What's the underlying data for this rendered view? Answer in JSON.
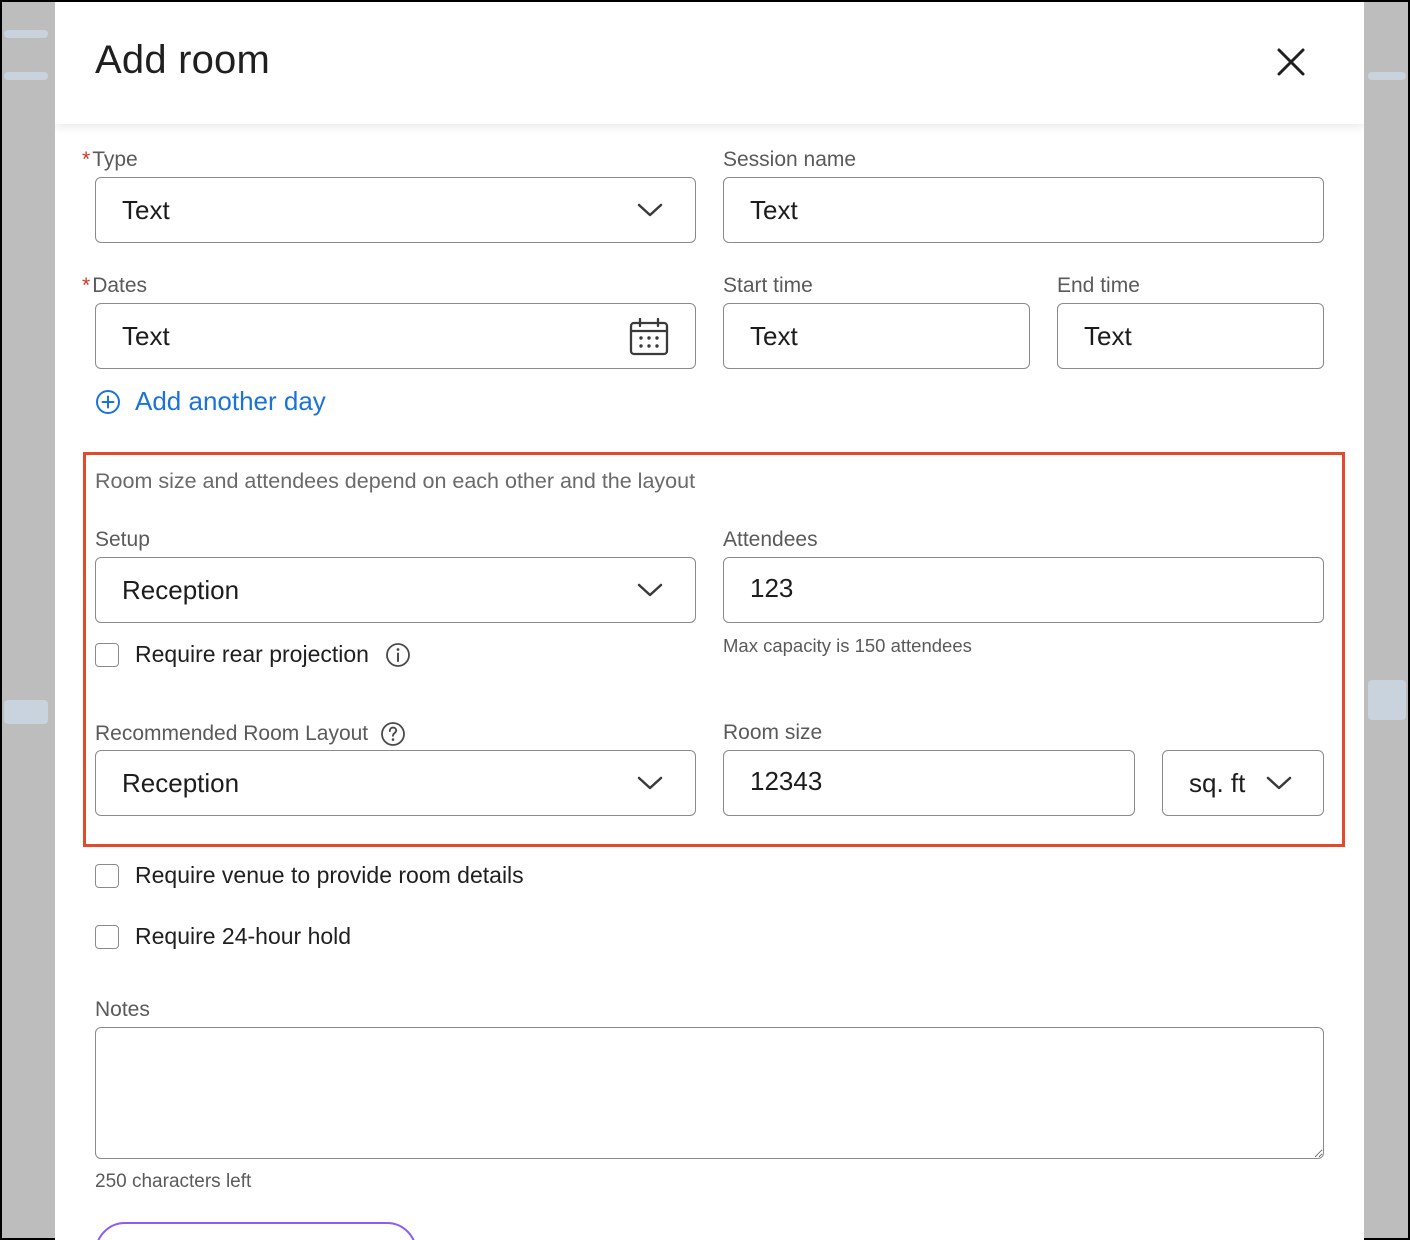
{
  "dialog": {
    "title": "Add room"
  },
  "form": {
    "type": {
      "label": "Type",
      "required": true,
      "value": "Text"
    },
    "session_name": {
      "label": "Session name",
      "value": "Text"
    },
    "dates": {
      "label": "Dates",
      "required": true,
      "value": "Text"
    },
    "start_time": {
      "label": "Start time",
      "value": "Text"
    },
    "end_time": {
      "label": "End time",
      "value": "Text"
    },
    "add_day_link": "Add another day"
  },
  "room_section": {
    "hint": "Room size and attendees depend on each other and the layout",
    "setup": {
      "label": "Setup",
      "value": "Reception"
    },
    "attendees": {
      "label": "Attendees",
      "value": "123",
      "help": "Max capacity is 150 attendees"
    },
    "rear_projection": {
      "label": "Require rear projection",
      "checked": false
    },
    "recommended_layout": {
      "label": "Recommended Room Layout",
      "value": "Reception"
    },
    "room_size": {
      "label": "Room size",
      "value": "12343",
      "unit": "sq. ft"
    }
  },
  "options": {
    "venue_details": {
      "label": "Require venue to provide room details",
      "checked": false
    },
    "hold_24h": {
      "label": "Require 24-hour hold",
      "checked": false
    }
  },
  "notes": {
    "label": "Notes",
    "value": "",
    "counter": "250 characters left"
  },
  "colors": {
    "required": "#d0341f",
    "link": "#1a73d9",
    "highlight": "#e24a2b",
    "button_border": "#8b5cf6"
  },
  "icons": [
    "close-icon",
    "chevron-down-icon",
    "calendar-icon",
    "add-circle-icon",
    "info-icon",
    "help-icon"
  ]
}
